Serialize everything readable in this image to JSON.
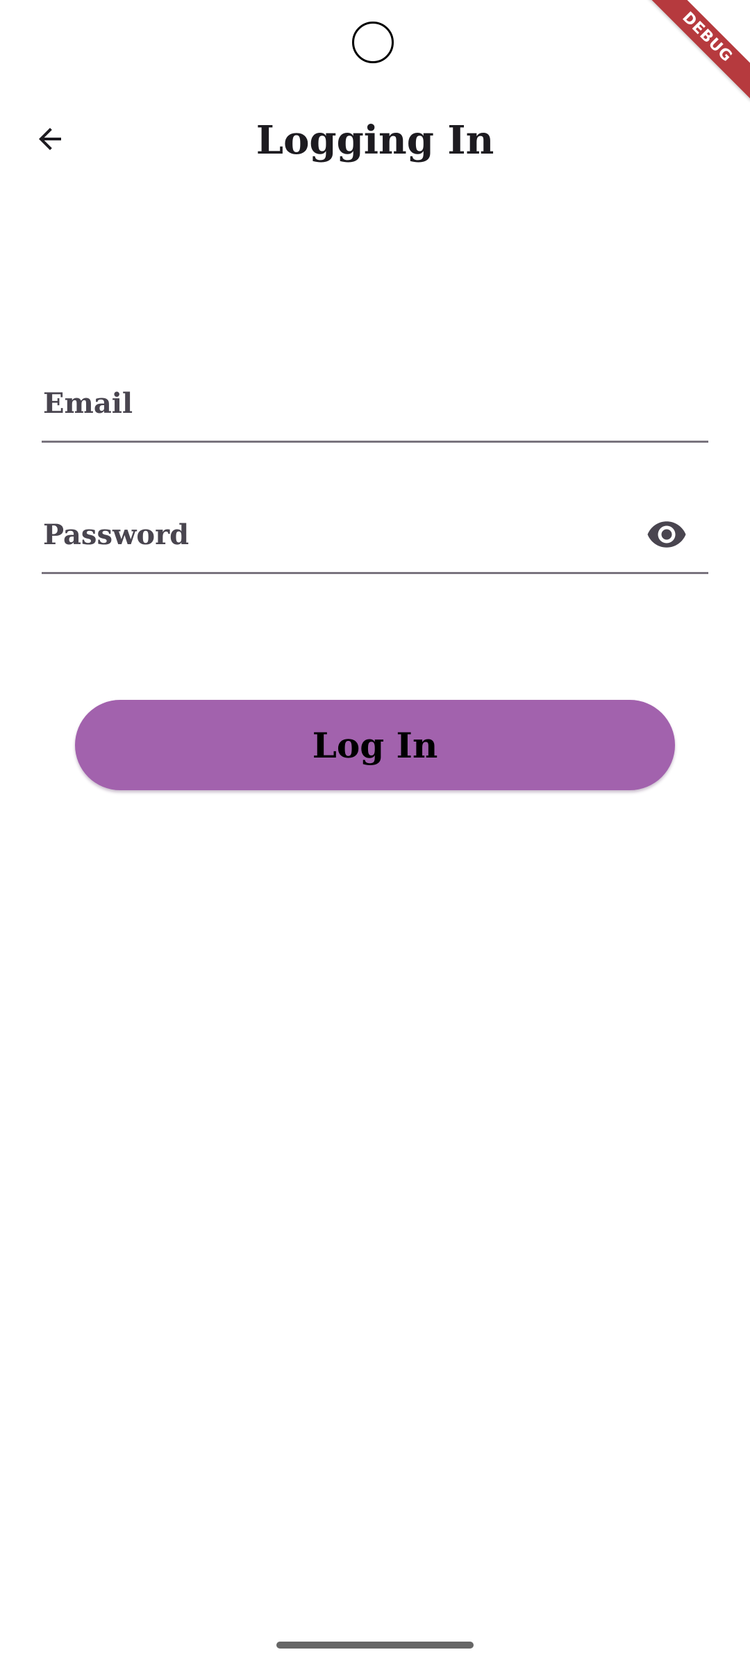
{
  "status_bar": {
    "debug_label": "DEBUG"
  },
  "appbar": {
    "title": "Logging In",
    "back_icon": "arrow-left-icon"
  },
  "form": {
    "email": {
      "placeholder": "Email",
      "value": ""
    },
    "password": {
      "placeholder": "Password",
      "value": "",
      "visibility_icon": "eye-icon"
    }
  },
  "login_button": {
    "label": "Log In",
    "color": "#a262ad"
  }
}
